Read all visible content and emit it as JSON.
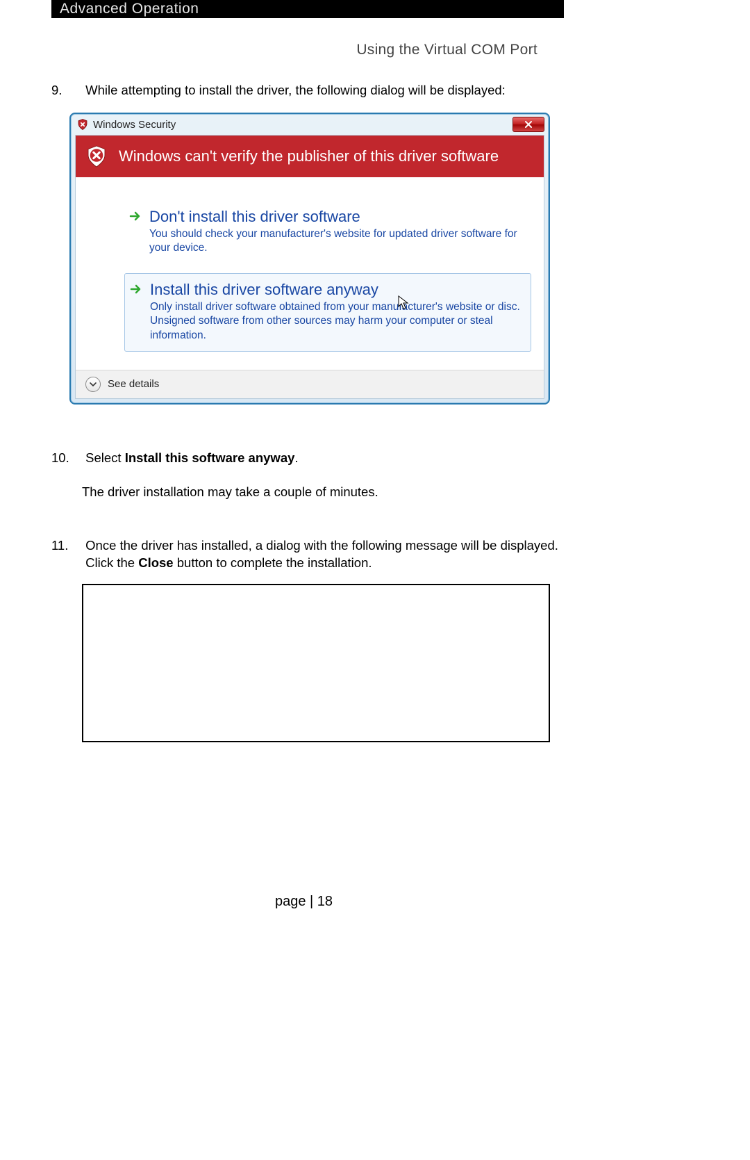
{
  "header": {
    "chapter": "Advanced Operation",
    "section": "Using the Virtual COM Port"
  },
  "steps": {
    "s9": {
      "num": "9.",
      "text": "While attempting to install the driver, the following dialog will be displayed:"
    },
    "s10": {
      "num": "10.",
      "prefix": "Select ",
      "bold": "Install this software anyway",
      "suffix": ".",
      "line2": "The driver installation may take a couple of minutes."
    },
    "s11": {
      "num": "11.",
      "text_a": "Once the driver has installed, a dialog with the following message will be displayed.  Click the ",
      "bold": "Close",
      "text_b": " button to complete the installation."
    }
  },
  "dialog": {
    "title": "Windows Security",
    "banner": "Windows can't verify the publisher of this driver software",
    "option1": {
      "title": "Don't install this driver software",
      "desc": "You should check your manufacturer's website for updated driver software for your device."
    },
    "option2": {
      "title": "Install this driver software anyway",
      "desc": "Only install driver software obtained from your manufacturer's website or disc. Unsigned software from other sources may harm your computer or steal information."
    },
    "see_details": "See details"
  },
  "footer": {
    "label": "page | 18"
  }
}
